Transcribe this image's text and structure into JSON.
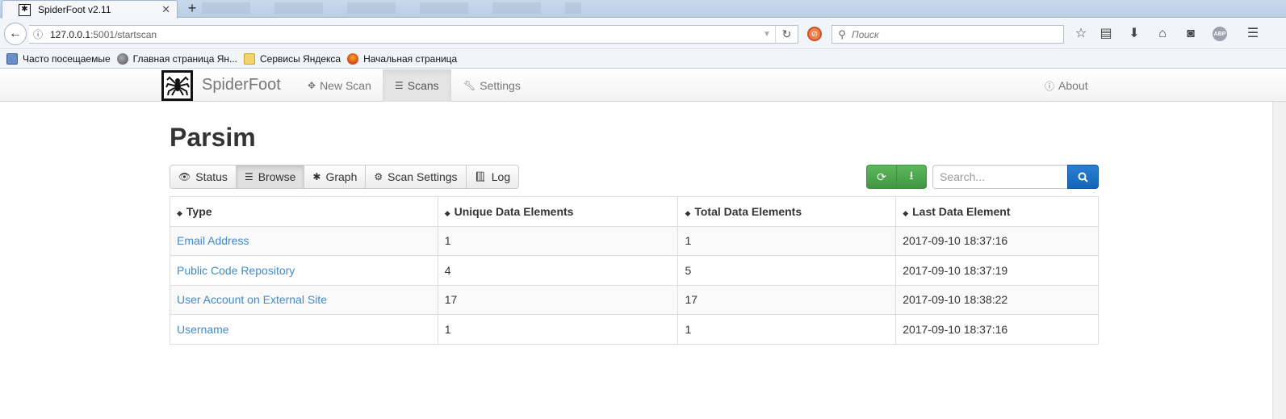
{
  "browser": {
    "tab_title": "SpiderFoot v2.11",
    "url_host": "127.0.0.1",
    "url_path": ":5001/startscan",
    "search_placeholder": "Поиск",
    "bookmarks": [
      {
        "label": "Часто посещаемые",
        "icon": "frequent-icon"
      },
      {
        "label": "Главная страница Ян...",
        "icon": "globe-icon"
      },
      {
        "label": "Сервисы Яндекса",
        "icon": "folder-icon"
      },
      {
        "label": "Начальная страница",
        "icon": "firefox-icon"
      }
    ]
  },
  "app": {
    "brand": "SpiderFoot",
    "nav": {
      "new_scan": "New Scan",
      "scans": "Scans",
      "settings": "Settings",
      "about": "About"
    },
    "title": "Parsim",
    "tabs": {
      "status": "Status",
      "browse": "Browse",
      "graph": "Graph",
      "scan_settings": "Scan Settings",
      "log": "Log"
    },
    "search_placeholder": "Search...",
    "table": {
      "headers": [
        "Type",
        "Unique Data Elements",
        "Total Data Elements",
        "Last Data Element"
      ],
      "rows": [
        {
          "type": "Email Address",
          "unique": "1",
          "total": "1",
          "last": "2017-09-10 18:37:16"
        },
        {
          "type": "Public Code Repository",
          "unique": "4",
          "total": "5",
          "last": "2017-09-10 18:37:19"
        },
        {
          "type": "User Account on External Site",
          "unique": "17",
          "total": "17",
          "last": "2017-09-10 18:38:22"
        },
        {
          "type": "Username",
          "unique": "1",
          "total": "1",
          "last": "2017-09-10 18:37:16"
        }
      ]
    }
  },
  "colors": {
    "link": "#428bca",
    "success": "#5cb85c",
    "primary": "#1565b8"
  }
}
